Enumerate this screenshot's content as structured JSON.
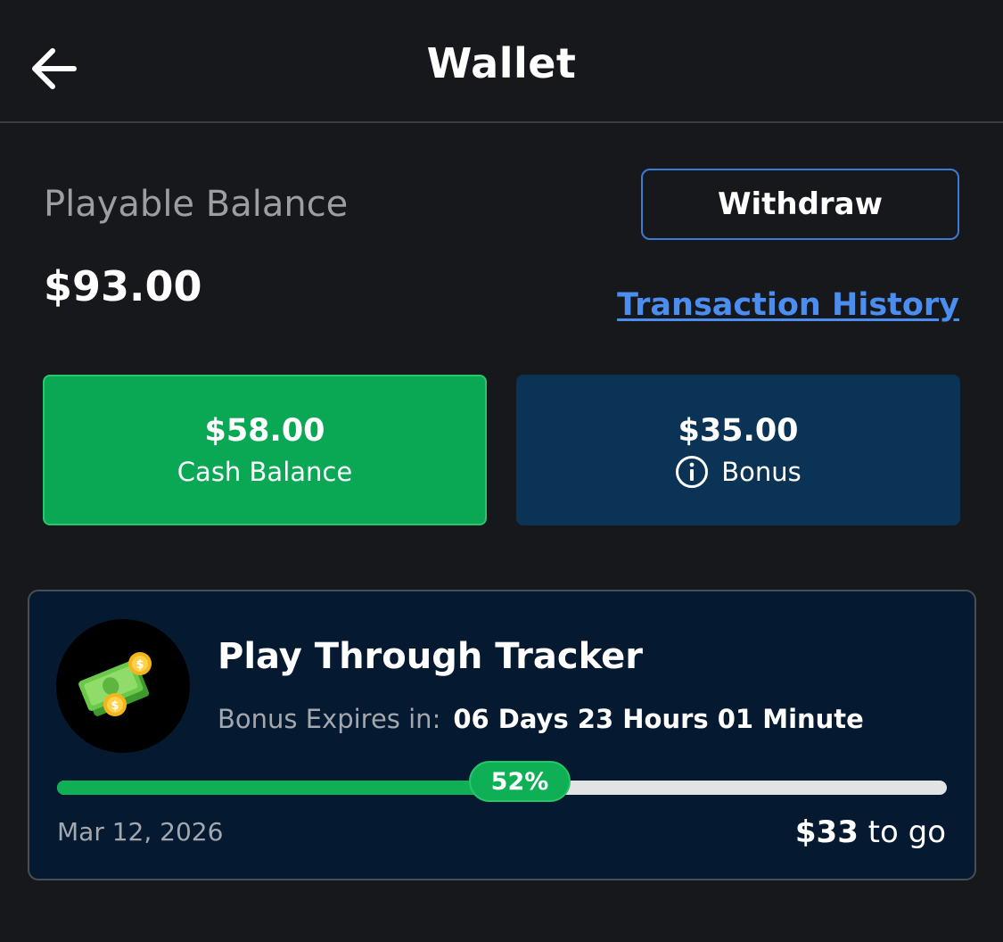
{
  "header": {
    "title": "Wallet",
    "back_icon": "arrow-left-icon"
  },
  "balance": {
    "label": "Playable Balance",
    "value": "$93.00",
    "withdraw_label": "Withdraw",
    "transaction_history_label": "Transaction History"
  },
  "tiles": {
    "cash": {
      "amount": "$58.00",
      "label": "Cash Balance",
      "color": "#0aa855"
    },
    "bonus": {
      "amount": "$35.00",
      "label": "Bonus",
      "icon": "info-icon",
      "color": "#0b3356"
    }
  },
  "tracker": {
    "title": "Play Through Tracker",
    "icon": "money-bills-coins-icon",
    "expires_label": "Bonus Expires in:",
    "expires_value": "06 Days 23 Hours 01 Minute",
    "progress": 0.52,
    "progress_label": "52%",
    "date": "Mar 12, 2026",
    "remaining_amount": "$33",
    "remaining_suffix": "to go",
    "accent": "#0fb055"
  }
}
